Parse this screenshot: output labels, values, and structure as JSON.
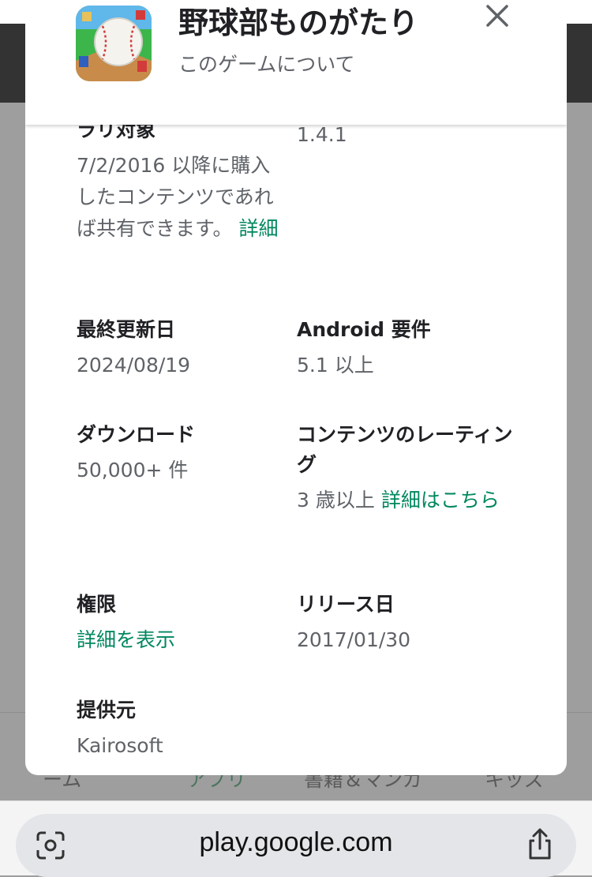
{
  "background": {
    "nav_items": [
      {
        "label": "ーム"
      },
      {
        "label": "アプリ"
      },
      {
        "label": "書籍＆マンガ"
      },
      {
        "label": "キッズ"
      }
    ]
  },
  "dialog": {
    "app_title": "野球部ものがたり",
    "subtitle": "このゲームについて",
    "top_left": {
      "label": "ラリ対象",
      "value": "7/2/2016 以降に購入したコンテンツであれば共有できます。",
      "link": "詳細"
    },
    "top_right": {
      "value": "1.4.1"
    },
    "info": [
      {
        "label": "最終更新日",
        "value": "2024/08/19"
      },
      {
        "label": "Android 要件",
        "value": "5.1 以上"
      },
      {
        "label": "ダウンロード",
        "value": "50,000+ 件"
      },
      {
        "label": "コンテンツのレーティング",
        "value": "3 歳以上",
        "link": "詳細はこちら"
      },
      {
        "label": "権限",
        "link": "詳細を表示"
      },
      {
        "label": "リリース日",
        "value": "2017/01/30"
      },
      {
        "label": "提供元",
        "value": "Kairosoft"
      }
    ]
  },
  "browser": {
    "url": "play.google.com"
  },
  "colors": {
    "link": "#01875f",
    "label": "#202124",
    "secondary_text": "#5f6368"
  },
  "icons": [
    "app-icon",
    "close-icon",
    "google-lens-icon",
    "share-icon"
  ]
}
